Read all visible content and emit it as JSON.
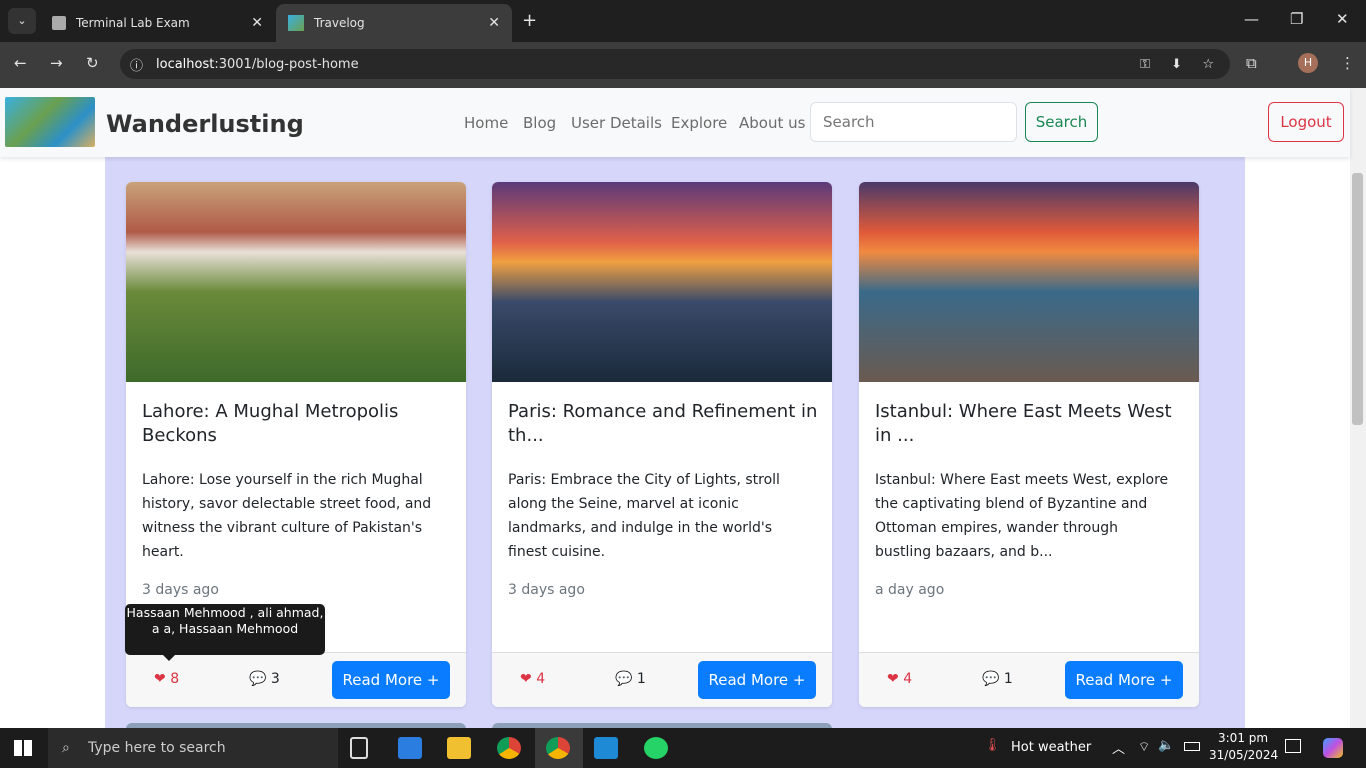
{
  "browser": {
    "tabs": [
      {
        "title": "Terminal Lab Exam"
      },
      {
        "title": "Travelog"
      }
    ],
    "url_host": "localhost",
    "url_rest": ":3001/blog-post-home"
  },
  "navbar": {
    "brand": "Wanderlusting",
    "links": [
      "Home",
      "Blog",
      "User Details",
      "Explore",
      "About us"
    ],
    "search_placeholder": "Search",
    "search_button": "Search",
    "logout_button": "Logout"
  },
  "cards": [
    {
      "title": "Lahore: A Mughal Metropolis Beckons",
      "excerpt": "Lahore: Lose yourself in the rich Mughal history, savor delectable street food, and witness the vibrant culture of Pakistan's heart.",
      "time": "3 days ago",
      "likes": "8",
      "comments": "3",
      "read_more": "Read More +"
    },
    {
      "title": "Paris: Romance and Refinement in th...",
      "excerpt": "Paris: Embrace the City of Lights, stroll along the Seine, marvel at iconic landmarks, and indulge in the world's finest cuisine.",
      "time": "3 days ago",
      "likes": "4",
      "comments": "1",
      "read_more": "Read More +"
    },
    {
      "title": "Istanbul: Where East Meets West in ...",
      "excerpt": "Istanbul: Where East meets West, explore the captivating blend of Byzantine and Ottoman empires, wander through bustling bazaars, and b...",
      "time": "a day ago",
      "likes": "4",
      "comments": "1",
      "read_more": "Read More +"
    }
  ],
  "tooltip": "Hassaan Mehmood , ali ahmad, a a, Hassaan Mehmood",
  "taskbar": {
    "search_placeholder": "Type here to search",
    "weather": "Hot weather",
    "time": "3:01 pm",
    "date": "31/05/2024"
  },
  "colors": {
    "like": "#dc3545",
    "primary": "#0a7cff",
    "content_bg": "#d6d6fa",
    "search_green": "#198754",
    "logout_red": "#dc3545"
  }
}
